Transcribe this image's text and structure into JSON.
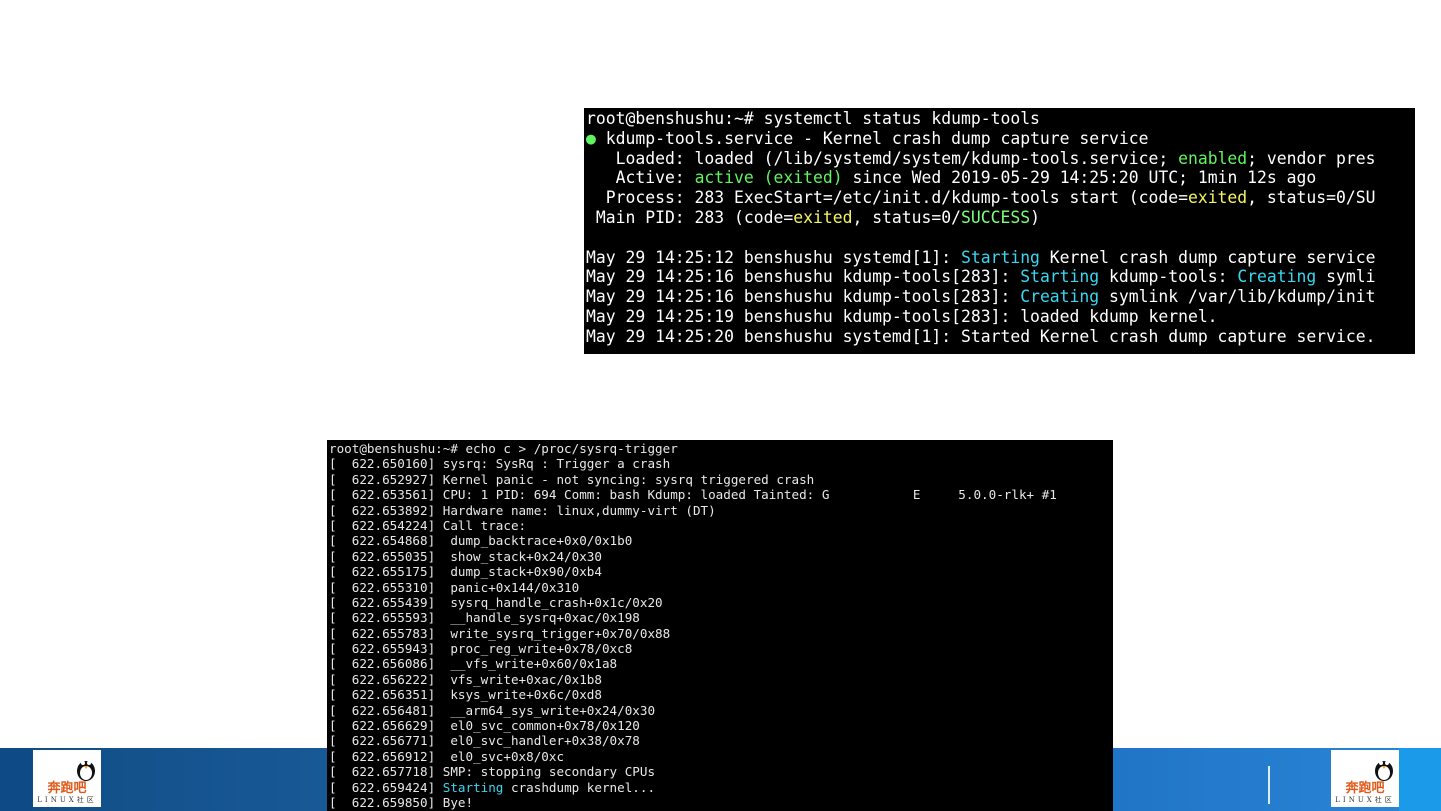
{
  "branding": {
    "logo_text": "奔跑吧",
    "logo_sub": "LINUX社区",
    "colors": {
      "banner": "#1b5fa0",
      "banner_accent": "#1a9ae8"
    }
  },
  "terminal1": {
    "prompt_line": "root@benshushu:~# systemctl status kdump-tools",
    "bullet": "●",
    "service_line": " kdump-tools.service - Kernel crash dump capture service",
    "loaded": {
      "pre": "   Loaded: loaded (/lib/systemd/system/kdump-tools.service; ",
      "hl": "enabled",
      "post": "; vendor pres"
    },
    "active": {
      "pre": "   Active: ",
      "hl": "active (exited)",
      "post": " since Wed 2019-05-29 14:25:20 UTC; 1min 12s ago"
    },
    "process": {
      "pre": "  Process: 283 ExecStart=/etc/init.d/kdump-tools start (code=",
      "hl": "exited",
      "post": ", status=0/SU"
    },
    "mainpid": {
      "pre": " Main PID: 283 (code=",
      "hl": "exited",
      "mid": ", status=0/",
      "hl2": "SUCCESS",
      "post": ")"
    },
    "blank": "",
    "log1": {
      "pre": "May 29 14:25:12 benshushu systemd[1]: ",
      "hl": "Starting",
      "post": " Kernel crash dump capture service"
    },
    "log2": {
      "pre": "May 29 14:25:16 benshushu kdump-tools[283]: ",
      "hl": "Starting",
      "mid": " kdump-tools: ",
      "hl2": "Creating",
      "post": " symli"
    },
    "log3": {
      "pre": "May 29 14:25:16 benshushu kdump-tools[283]: ",
      "hl": "Creating",
      "post": " symlink /var/lib/kdump/init"
    },
    "log4": "May 29 14:25:19 benshushu kdump-tools[283]: loaded kdump kernel.",
    "log5": "May 29 14:25:20 benshushu systemd[1]: Started Kernel crash dump capture service."
  },
  "terminal2": {
    "prompt_line": "root@benshushu:~# echo c > /proc/sysrq-trigger",
    "lines": [
      "[  622.650160] sysrq: SysRq : Trigger a crash",
      "[  622.652927] Kernel panic - not syncing: sysrq triggered crash",
      "[  622.653561] CPU: 1 PID: 694 Comm: bash Kdump: loaded Tainted: G           E     5.0.0-rlk+ #1",
      "[  622.653892] Hardware name: linux,dummy-virt (DT)",
      "[  622.654224] Call trace:",
      "[  622.654868]  dump_backtrace+0x0/0x1b0",
      "[  622.655035]  show_stack+0x24/0x30",
      "[  622.655175]  dump_stack+0x90/0xb4",
      "[  622.655310]  panic+0x144/0x310",
      "[  622.655439]  sysrq_handle_crash+0x1c/0x20",
      "[  622.655593]  __handle_sysrq+0xac/0x198",
      "[  622.655783]  write_sysrq_trigger+0x70/0x88",
      "[  622.655943]  proc_reg_write+0x78/0xc8",
      "[  622.656086]  __vfs_write+0x60/0x1a8",
      "[  622.656222]  vfs_write+0xac/0x1b8",
      "[  622.656351]  ksys_write+0x6c/0xd8",
      "[  622.656481]  __arm64_sys_write+0x24/0x30",
      "[  622.656629]  el0_svc_common+0x78/0x120",
      "[  622.656771]  el0_svc_handler+0x38/0x78",
      "[  622.656912]  el0_svc+0x8/0xc",
      "[  622.657718] SMP: stopping secondary CPUs"
    ],
    "crash_line": {
      "pre": "[  622.659424] ",
      "hl": "Starting",
      "post": " crashdump kernel..."
    },
    "bye_line": "[  622.659850] Bye!"
  }
}
